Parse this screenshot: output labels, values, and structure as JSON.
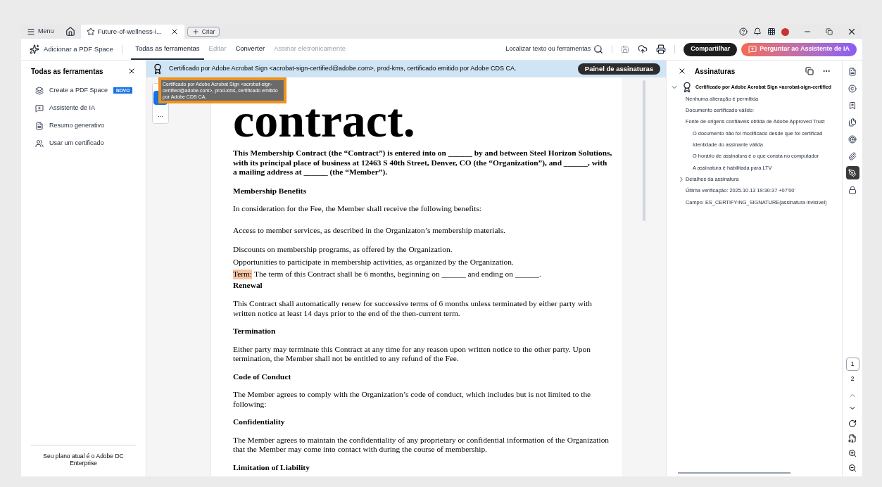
{
  "title_bar": {
    "menu": "Menu",
    "tab": {
      "title": "Future-of-wellness-i...",
      "selected": true
    },
    "new_button": "Criar"
  },
  "toolbar": {
    "add_space": "Adicionar a PDF Space",
    "tabs": [
      {
        "label": "Todas as ferramentas",
        "selected": true,
        "disabled": false
      },
      {
        "label": "Editar",
        "selected": false,
        "disabled": true
      },
      {
        "label": "Converter",
        "selected": false,
        "disabled": false
      },
      {
        "label": "Assinar eletronicamente",
        "selected": false,
        "disabled": true
      }
    ],
    "search": "Localizar texto ou ferramentas",
    "share": "Compartilhar",
    "ask_ai": "Perguntar ao Assistente de IA"
  },
  "left_panel": {
    "title": "Todas as ferramentas",
    "items": [
      {
        "label": "Create a PDF Space",
        "badge": "NOVO"
      },
      {
        "label": "Assistente de IA"
      },
      {
        "label": "Resumo generativo"
      },
      {
        "label": "Usar um certificado"
      }
    ],
    "plan": "Seu plano atual é o Adobe DC Enterprise"
  },
  "banner": {
    "text": "Certificado por Adobe Acrobat Sign <acrobat-sign-certified@adobe.com>, prod-kms, certificado emitido por Adobe CDS CA.",
    "button": "Painel de assinaturas"
  },
  "tooltip": "Certificado por Adobe Acrobat Sign <acrobat-sign-certified@adobe.com>, prod-kms, certificado emitido por Adobe CDS CA.",
  "thumbnail_more": "...",
  "document": [
    {
      "kind": "title",
      "text": "contract."
    },
    {
      "kind": "bold",
      "text": "This Membership Contract (the “Contract”) is entered into on ______ by and between Steel Horizon Solutions, with its principal place of business at 12463 S 40th Street, Denver, CO (the “Organization”), and ______, with a mailing address at ______ (the “Member”)."
    },
    {
      "kind": "heading",
      "text": "Membership Benefits"
    },
    {
      "kind": "paragraph",
      "text": "In consideration for the Fee, the Member shall receive the following benefits:"
    },
    {
      "kind": "spaced",
      "text": "Access to member services, as described in the Organizaton’s membership materials."
    },
    {
      "kind": "paragraph",
      "text": "Discounts on membership programs, as offered by the Organization."
    },
    {
      "kind": "line",
      "text": "Opportunities to participate in membership activities, as organized by the Organization."
    },
    {
      "kind": "line",
      "highlight": "Term:",
      "text": "The term of this Contract shall be 6 months, beginning on ______ and ending on ______."
    },
    {
      "kind": "tight_heading",
      "text": "Renewal"
    },
    {
      "kind": "paragraph",
      "text": "This Contract shall automatically renew for successive terms of 6 months unless terminated by either party with written notice at least 14 days prior to the end of the then-current term."
    },
    {
      "kind": "heading",
      "text": "Termination"
    },
    {
      "kind": "paragraph",
      "text": "Either party may terminate this Contract at any time for any reason upon written notice to the other party. Upon termination, the Member shall not be entitled to any refund of the Fee."
    },
    {
      "kind": "heading",
      "text": "Code of Conduct"
    },
    {
      "kind": "paragraph",
      "text": "The Member agrees to comply with the Organization’s code of conduct, which includes but is not limited to the following:"
    },
    {
      "kind": "heading",
      "text": "Confidentiality"
    },
    {
      "kind": "paragraph",
      "text": "The Member agrees to maintain the confidentiality of any proprietary or confidential information of the Organization that the Member may come into contact with during the course of membership."
    },
    {
      "kind": "heading",
      "text": "Limitation of Liability"
    }
  ],
  "signatures": {
    "title": "Assinaturas",
    "tree": [
      {
        "label": "Certificado por Adobe Acrobat Sign <acrobat-sign-certified",
        "expanded": true,
        "children": [
          {
            "label": "Nenhuma alteração é permitida"
          },
          {
            "label": "Documento certificado válido:"
          },
          {
            "label": "Fonte de origens confiáveis obtida de Adobe Approved Trust",
            "children": [
              {
                "label": "O documento não foi modificado desde que foi certificad"
              },
              {
                "label": "Identidade do assinante válida"
              },
              {
                "label": "O horário de assinatura é o que consta no computador"
              },
              {
                "label": "A assinatura é habilitada para LTV"
              }
            ]
          },
          {
            "label": "Detalhes da assinatura",
            "expanded": false
          },
          {
            "label": "Última verificação: 2025.10.13 19:30:37 +07'00'"
          },
          {
            "label": "Campo: ES_CERTIFYING_SIGNATURE(assinatura invisível)"
          }
        ]
      }
    ]
  },
  "rail": [
    {
      "selected": false
    },
    {
      "selected": false
    },
    {
      "selected": false
    },
    {
      "selected": false
    },
    {
      "selected": false
    },
    {
      "selected": false
    },
    {
      "selected": true
    },
    {
      "selected": false
    }
  ],
  "pages": [
    {
      "label": "1",
      "selected": true
    },
    {
      "label": "2",
      "selected": false
    }
  ]
}
